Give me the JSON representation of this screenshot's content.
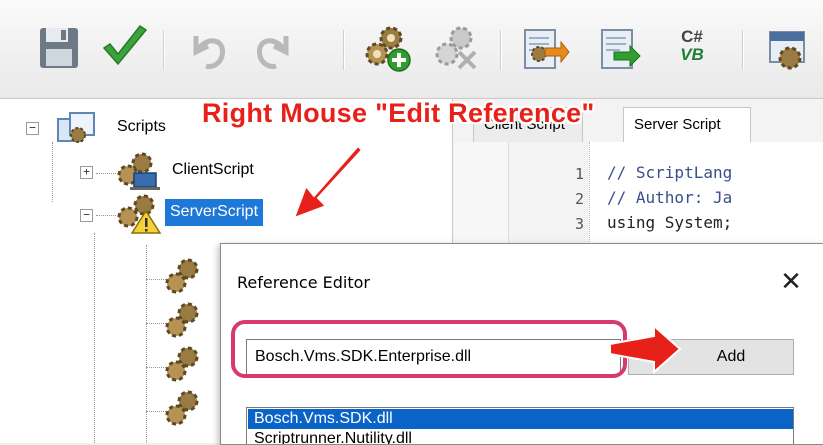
{
  "toolbar": {
    "buttons": [
      {
        "name": "save-icon"
      },
      {
        "name": "check-icon"
      },
      {
        "name": "undo-icon"
      },
      {
        "name": "redo-icon"
      },
      {
        "name": "add-script-icon"
      },
      {
        "name": "remove-script-icon"
      },
      {
        "name": "import-icon"
      },
      {
        "name": "export-icon"
      },
      {
        "name": "convert-csharp-vb-icon"
      },
      {
        "name": "sdk-icon"
      }
    ],
    "convert_top_label": "C#",
    "convert_bottom_label": "VB"
  },
  "tree": {
    "root_label": "Scripts",
    "client_label": "ClientScript",
    "server_label": "ServerScript"
  },
  "editor": {
    "tabs": [
      {
        "label": "Client Script",
        "active": false
      },
      {
        "label": "Server Script",
        "active": true
      }
    ],
    "lines": [
      {
        "num": "1",
        "text": "// ScriptLang",
        "kind": "comment"
      },
      {
        "num": "2",
        "text": "// Author: Ja",
        "kind": "comment"
      },
      {
        "num": "3",
        "text": "using System;",
        "kind": "code"
      }
    ]
  },
  "dialog": {
    "title": "Reference Editor",
    "close_glyph": "✕",
    "input_value": "Bosch.Vms.SDK.Enterprise.dll",
    "add_label": "Add",
    "list": [
      "Bosch.Vms.SDK.dll",
      "Scriptrunner.Nutility.dll"
    ],
    "selected_index": 0
  },
  "annotation": {
    "text": "Right Mouse \"Edit Reference\"",
    "color": "#e8201a",
    "box_color": "#d83a6e"
  },
  "colors": {
    "selection": "#1e78d7",
    "list_selection": "#0a64c8"
  }
}
